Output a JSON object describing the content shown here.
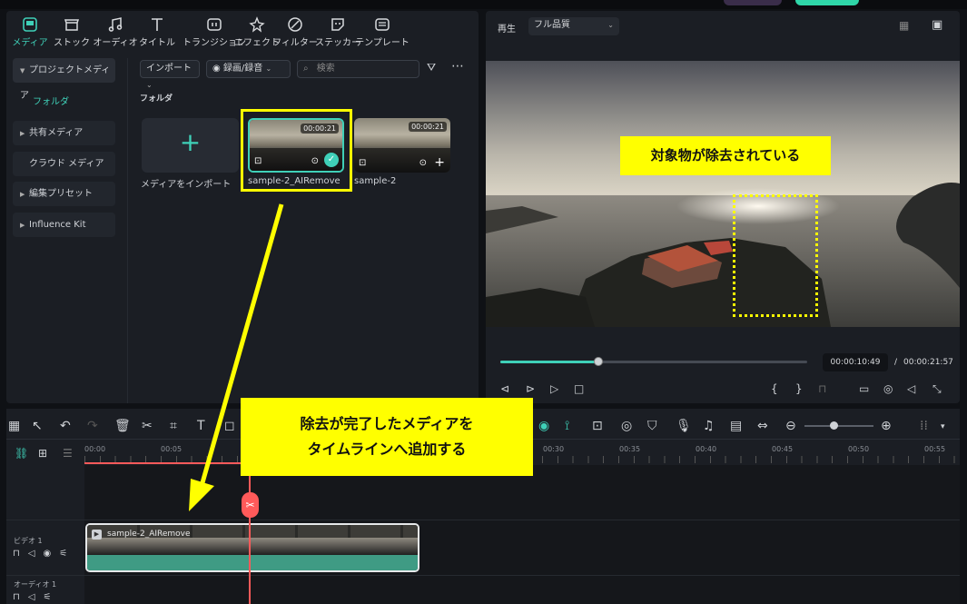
{
  "tabs": [
    {
      "label": "メディア",
      "icon": "media-icon"
    },
    {
      "label": "ストック",
      "icon": "stock-icon"
    },
    {
      "label": "オーディオ",
      "icon": "audio-icon"
    },
    {
      "label": "タイトル",
      "icon": "title-icon"
    },
    {
      "label": "トランジション",
      "icon": "transition-icon"
    },
    {
      "label": "エフェクト",
      "icon": "effect-icon"
    },
    {
      "label": "フィルター",
      "icon": "filter-icon"
    },
    {
      "label": "ステッカー",
      "icon": "sticker-icon"
    },
    {
      "label": "テンプレート",
      "icon": "template-icon"
    }
  ],
  "sidebar": {
    "project_media": "プロジェクトメディア",
    "folder": "フォルダ",
    "shared_media": "共有メディア",
    "cloud_media": "クラウド メディア",
    "edit_preset": "編集プリセット",
    "influence_kit": "Influence Kit"
  },
  "toolbar": {
    "import": "インポート",
    "record": "録画/録音",
    "search_placeholder": "検索"
  },
  "media": {
    "section": "フォルダ",
    "import_label": "メディアをインポート",
    "items": [
      {
        "name": "sample-2_AIRemove",
        "duration": "00:00:21"
      },
      {
        "name": "sample-2",
        "duration": "00:00:21"
      }
    ]
  },
  "player": {
    "mode": "再生",
    "quality": "フル品質",
    "current_time": "00:00:10:49",
    "separator": "/",
    "total_time": "00:00:21:57",
    "progress": 0.32
  },
  "callouts": {
    "removed": "対象物が除去されている",
    "add_line1": "除去が完了したメディアを",
    "add_line2": "タイムラインへ追加する"
  },
  "ruler": [
    "00:00",
    "00:05",
    "00:30",
    "00:35",
    "00:40",
    "00:45",
    "00:50",
    "00:55"
  ],
  "tracks": {
    "video": "ビデオ 1",
    "audio": "オーディオ 1",
    "clip_name": "sample-2_AIRemove"
  },
  "colors": {
    "accent": "#3fd0b8",
    "callout": "#ffff00",
    "playhead": "#ff5a5a",
    "clip": "#3f9b84"
  }
}
